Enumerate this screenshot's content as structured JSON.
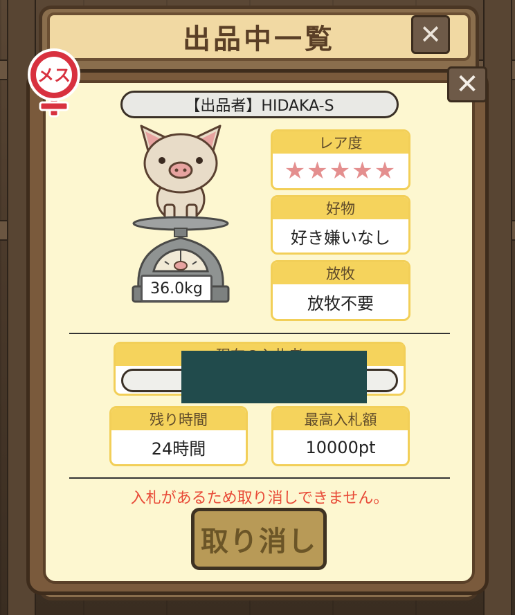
{
  "window": {
    "title": "出品中一覧"
  },
  "listing": {
    "seller_label": "【出品者】HIDAKA-S",
    "gender_label": "メス",
    "weight": "36.0kg",
    "rarity": {
      "label": "レア度",
      "stars": "★★★★★"
    },
    "favorite": {
      "label": "好物",
      "value": "好き嫌いなし"
    },
    "grazing": {
      "label": "放牧",
      "value": "放牧不要"
    },
    "current_bidder": {
      "label": "現在の入札者"
    },
    "remaining_time": {
      "label": "残り時間",
      "value": "24時間"
    },
    "highest_bid": {
      "label": "最高入札額",
      "value": "10000pt"
    },
    "warning": "入札があるため取り消しできません。",
    "cancel_label": "取り消し"
  },
  "icons": [
    "close-icon",
    "female-icon",
    "pig-icon",
    "scale-icon"
  ],
  "colors": {
    "accent_yellow": "#f5d35c",
    "star_pink": "#e48f8f",
    "warning_red": "#e84b38"
  }
}
